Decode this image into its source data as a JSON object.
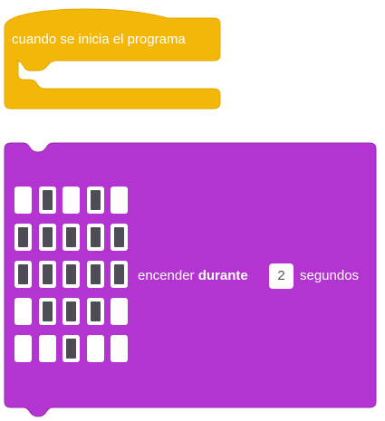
{
  "hat_block": {
    "label": "cuando se inicia el programa",
    "color": "#f3b807",
    "stroke": "#e0a800"
  },
  "display_block": {
    "color": "#b434d1",
    "stroke": "#9a25b6",
    "text_before": "encender",
    "text_bold": "durante",
    "duration_value": "2",
    "text_after": "segundos",
    "matrix": [
      [
        0,
        1,
        0,
        1,
        0
      ],
      [
        1,
        1,
        1,
        1,
        1
      ],
      [
        1,
        1,
        1,
        1,
        1
      ],
      [
        0,
        1,
        1,
        1,
        0
      ],
      [
        0,
        0,
        1,
        0,
        0
      ]
    ]
  }
}
